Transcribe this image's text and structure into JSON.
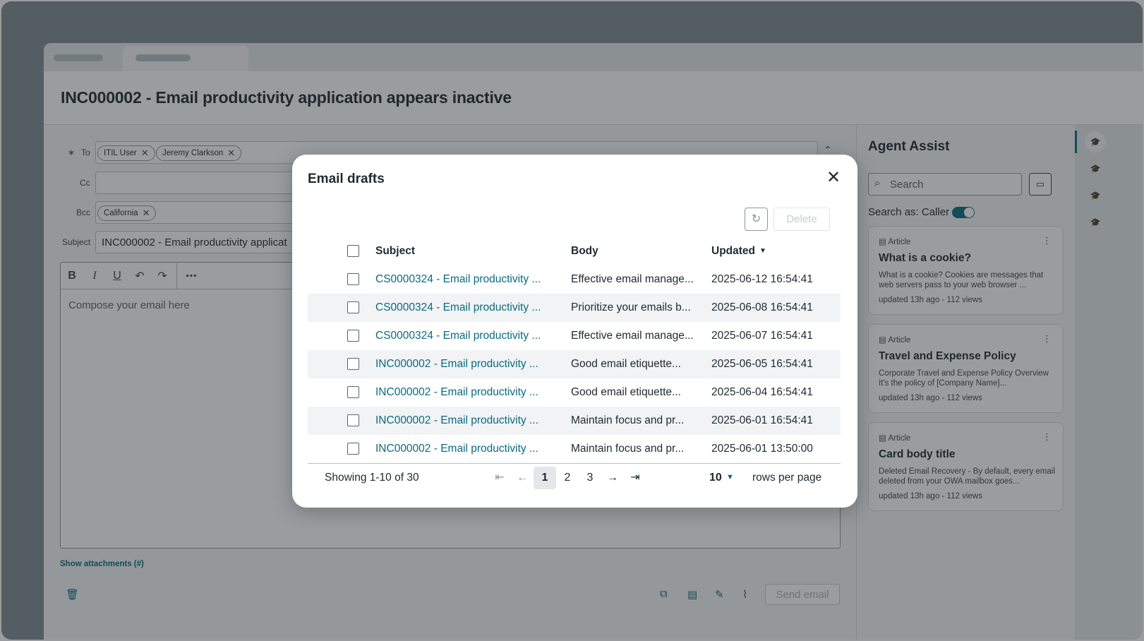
{
  "record": {
    "title": "INC000002 - Email productivity application appears inactive"
  },
  "compose": {
    "to_label": "To",
    "to_required": "∗",
    "to_chips": [
      "ITIL User",
      "Jeremy Clarkson"
    ],
    "cc_label": "Cc",
    "bcc_label": "Bcc",
    "bcc_chips": [
      "California"
    ],
    "subject_label": "Subject",
    "subject_value": "INC000002 - Email productivity applicat",
    "editor_placeholder": "Compose your email here",
    "show_attachments": "Show attachments (#)",
    "send_label": "Send email"
  },
  "agent_assist": {
    "title": "Agent Assist",
    "search_placeholder": "Search",
    "search_as": "Search as: Caller",
    "cards": [
      {
        "kind": "Article",
        "title": "What is a cookie?",
        "body": "What is a cookie? Cookies are messages that web servers pass to your web browser ...",
        "meta": "updated 13h ago - 112 views"
      },
      {
        "kind": "Article",
        "title": "Travel and Expense Policy",
        "body": "Corporate Travel and Expense Policy Overview It's the policy of [Company Name]...",
        "meta": "updated 13h ago - 112 views"
      },
      {
        "kind": "Article",
        "title": "Card body title",
        "body": "Deleted Email Recovery - By default, every email deleted from your OWA mailbox goes...",
        "meta": "updated 13h ago - 112 views"
      }
    ]
  },
  "modal": {
    "title": "Email drafts",
    "delete_label": "Delete",
    "columns": {
      "subject": "Subject",
      "body": "Body",
      "updated": "Updated"
    },
    "rows": [
      {
        "subject": "CS0000324 - Email productivity ...",
        "body": "Effective email manage...",
        "updated": "2025-06-12 16:54:41"
      },
      {
        "subject": "CS0000324 - Email productivity ...",
        "body": "Prioritize your emails b...",
        "updated": "2025-06-08 16:54:41"
      },
      {
        "subject": "CS0000324 - Email productivity ...",
        "body": "Effective email manage...",
        "updated": "2025-06-07 16:54:41"
      },
      {
        "subject": "INC000002 - Email productivity ...",
        "body": "Good email etiquette...",
        "updated": "2025-06-05 16:54:41"
      },
      {
        "subject": "INC000002 - Email productivity ...",
        "body": "Good email etiquette...",
        "updated": "2025-06-04 16:54:41"
      },
      {
        "subject": "INC000002 - Email productivity ...",
        "body": "Maintain focus and pr...",
        "updated": "2025-06-01 16:54:41"
      },
      {
        "subject": "INC000002 - Email productivity ...",
        "body": "Maintain focus and pr...",
        "updated": "2025-06-01 13:50:00"
      }
    ],
    "footer": {
      "showing": "Showing 1-10 of 30",
      "pages": [
        "1",
        "2",
        "3"
      ],
      "current_page": "1",
      "rows_per_page_value": "10",
      "rows_per_page_label": "rows per page"
    }
  },
  "icons": {
    "close": "close-icon",
    "refresh": "refresh-icon",
    "sort": "sort-descending-icon",
    "first": "first-page-icon",
    "prev": "previous-page-icon",
    "next": "next-page-icon",
    "last": "last-page-icon"
  },
  "colors": {
    "accent": "#0b6a80",
    "overlay": "#1e262a"
  }
}
